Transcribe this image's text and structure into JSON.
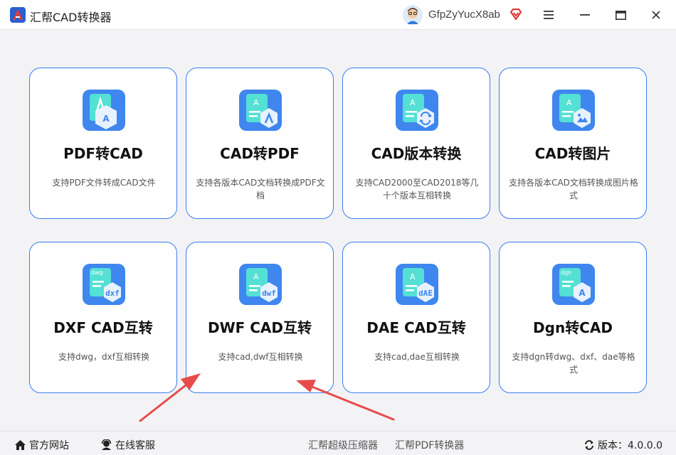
{
  "app": {
    "title": "汇帮CAD转换器",
    "accent": "#3a7df0",
    "logo_icon": "app-logo-icon"
  },
  "titlebar": {
    "username": "GfpZyYucX8ab",
    "avatar_icon": "user-avatar-icon",
    "vip_icon": "vip-diamond-icon",
    "menu_icon": "hamburger-menu-icon",
    "minimize_icon": "minimize-icon",
    "maximize_icon": "maximize-icon",
    "close_icon": "close-icon"
  },
  "cards": [
    {
      "title": "PDF转CAD",
      "desc": "支持PDF文件转成CAD文件",
      "icon": "pdf-to-cad-icon"
    },
    {
      "title": "CAD转PDF",
      "desc": "支持各版本CAD文档转换成PDF文档",
      "icon": "cad-to-pdf-icon"
    },
    {
      "title": "CAD版本转换",
      "desc": "支持CAD2000至CAD2018等几十个版本互相转换",
      "icon": "cad-version-convert-icon"
    },
    {
      "title": "CAD转图片",
      "desc": "支持各版本CAD文档转换成图片格式",
      "icon": "cad-to-image-icon"
    },
    {
      "title": "DXF CAD互转",
      "desc": "支持dwg，dxf互相转换",
      "icon": "dxf-convert-icon"
    },
    {
      "title": "DWF CAD互转",
      "desc": "支持cad,dwf互相转换",
      "icon": "dwf-convert-icon"
    },
    {
      "title": "DAE CAD互转",
      "desc": "支持cad,dae互相转换",
      "icon": "dae-convert-icon"
    },
    {
      "title": "Dgn转CAD",
      "desc": "支持dgn转dwg、dxf、dae等格式",
      "icon": "dgn-to-cad-icon"
    }
  ],
  "footer": {
    "website": "官方网站",
    "support": "在线客服",
    "compressor": "汇帮超级压缩器",
    "pdf_converter": "汇帮PDF转换器",
    "version_label": "版本：4.0.0.0"
  },
  "annotation_color": "#e84a4a"
}
